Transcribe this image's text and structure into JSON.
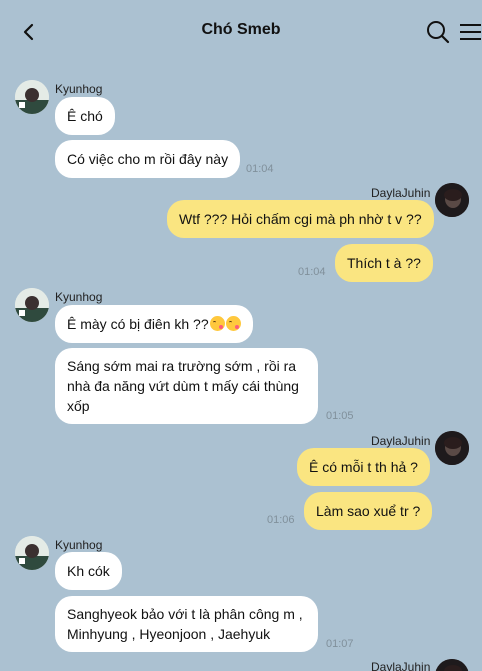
{
  "header": {
    "title": "Chó Smeb",
    "icons": [
      "back-arrow-icon",
      "search-icon",
      "hamburger-menu-icon"
    ]
  },
  "colors": {
    "background": "#abc1d1",
    "incoming_bubble": "#ffffff",
    "outgoing_bubble": "#fae581"
  },
  "users": {
    "kyunhog": "Kyunhog",
    "daylajuhin": "DaylaJuhin"
  },
  "messages": {
    "g1": {
      "m1": "Ê chó",
      "m2": "Có việc cho m rồi đây này",
      "time": "01:04"
    },
    "g2": {
      "m1": "Wtf ??? Hỏi chấm cgi mà ph nhờ t v ??",
      "m2": "Thích t à ??",
      "time": "01:04"
    },
    "g3": {
      "m1": "Ê mày có bị điên kh ??",
      "m1_emoji": [
        "face-blowing-kiss-emoji",
        "face-blowing-kiss-emoji"
      ],
      "m2": "Sáng sớm mai ra trường sớm , rồi ra nhà đa năng vứt dùm t mấy cái thùng xốp",
      "time": "01:05"
    },
    "g4": {
      "m1": "Ê có mỗi t th hả ?",
      "m2": "Làm sao xuể tr ?",
      "time": "01:06"
    },
    "g5": {
      "m1": "Kh cók",
      "m2": "Sanghyeok bảo với t là phân công m , Minhyung , Hyeonjoon , Jaehyuk",
      "time": "01:07"
    }
  }
}
